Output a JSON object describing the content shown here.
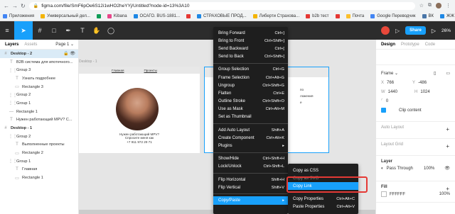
{
  "browser": {
    "url": "figma.com/file/SmF6pOe6S12i1wHO2heYYj/Untitled?node-id=13%3A10"
  },
  "bookmarks": [
    {
      "label": "Приложения",
      "color": "#4285f4"
    },
    {
      "label": "Универсальный дел...",
      "color": "#f4b400"
    },
    {
      "label": "",
      "color": "#0f9d58"
    },
    {
      "label": "Kibana",
      "color": "#e8478b"
    },
    {
      "label": "ОСАГО. BUS-1881...",
      "color": "#1e88e5"
    },
    {
      "label": "",
      "color": "#e53935"
    },
    {
      "label": "СТРАХОВЫЕ ПРОД...",
      "color": "#1e88e5"
    },
    {
      "label": "Либерти Страхова...",
      "color": "#f4b400"
    },
    {
      "label": "b2b тест",
      "color": "#e53935"
    },
    {
      "label": "",
      "color": "#e53935"
    },
    {
      "label": "Почта",
      "color": "#fbc02d"
    },
    {
      "label": "Google Переводчик",
      "color": "#4285f4"
    },
    {
      "label": "ВК",
      "color": "#4a76a8"
    },
    {
      "label": "ЖЖ",
      "color": "#1e88e5"
    }
  ],
  "toolbar": {
    "share_label": "Share",
    "zoom": "26%"
  },
  "left_panel": {
    "tabs": [
      "Layers",
      "Assets"
    ],
    "page_label": "Page 1 ⌄",
    "layers": [
      {
        "name": "Desktop - 2",
        "icon": "#",
        "indent": 0,
        "selected": true,
        "bold": true
      },
      {
        "name": "B2B система для ипотечного...",
        "icon": "T",
        "indent": 1
      },
      {
        "name": "Group 3",
        "icon": "⋮⋮",
        "indent": 1
      },
      {
        "name": "Узнать подробнее",
        "icon": "T",
        "indent": 2
      },
      {
        "name": "Rectangle 3",
        "icon": "▭",
        "indent": 2
      },
      {
        "name": "Group 2",
        "icon": "⋮⋮",
        "indent": 1
      },
      {
        "name": "Group 1",
        "icon": "⋮⋮",
        "indent": 1
      },
      {
        "name": "Rectangle 1",
        "icon": "—",
        "indent": 1
      },
      {
        "name": "Нужен работающий MPV? C...",
        "icon": "T",
        "indent": 1
      },
      {
        "name": "Desktop - 1",
        "icon": "#",
        "indent": 0,
        "bold": true
      },
      {
        "name": "Group 2",
        "icon": "⋮⋮",
        "indent": 1
      },
      {
        "name": "Выполненные проекты",
        "icon": "T",
        "indent": 2
      },
      {
        "name": "Rectangle 2",
        "icon": "▭",
        "indent": 2
      },
      {
        "name": "Group 1",
        "icon": "⋮⋮",
        "indent": 1
      },
      {
        "name": "Главная",
        "icon": "T",
        "indent": 2
      },
      {
        "name": "Rectangle 1",
        "icon": "▭",
        "indent": 2
      }
    ]
  },
  "canvas": {
    "frame_label": "Desktop - 1",
    "nav": [
      "Главная",
      "Проекты"
    ],
    "caption_lines": [
      "Нужен работающий MPV?",
      "Спросите меня как",
      "+7 911 972 29 71"
    ],
    "frame2_lines": [
      "по",
      "ложения",
      "е"
    ]
  },
  "context_menu": {
    "groups": [
      [
        {
          "label": "Bring Forward",
          "shortcut": "Ctrl+]"
        },
        {
          "label": "Bring to Front",
          "shortcut": "Ctrl+Shift+]"
        },
        {
          "label": "Send Backward",
          "shortcut": "Ctrl+["
        },
        {
          "label": "Send to Back",
          "shortcut": "Ctrl+Shift+["
        }
      ],
      [
        {
          "label": "Group Selection",
          "shortcut": "Ctrl+G"
        },
        {
          "label": "Frame Selection",
          "shortcut": "Ctrl+Alt+G"
        },
        {
          "label": "Ungroup",
          "shortcut": "Ctrl+Shift+G"
        },
        {
          "label": "Flatten",
          "shortcut": "Ctrl+E"
        },
        {
          "label": "Outline Stroke",
          "shortcut": "Ctrl+Shift+O"
        },
        {
          "label": "Use as Mask",
          "shortcut": "Ctrl+Alt+M"
        },
        {
          "label": "Set as Thumbnail",
          "shortcut": ""
        }
      ],
      [
        {
          "label": "Add Auto Layout",
          "shortcut": "Shift+A"
        },
        {
          "label": "Create Component",
          "shortcut": "Ctrl+Alt+K"
        },
        {
          "label": "Plugins",
          "shortcut": "▸"
        }
      ],
      [
        {
          "label": "Show/Hide",
          "shortcut": "Ctrl+Shift+H"
        },
        {
          "label": "Lock/Unlock",
          "shortcut": "Ctrl+Shift+L"
        }
      ],
      [
        {
          "label": "Flip Horizontal",
          "shortcut": "Shift+H"
        },
        {
          "label": "Flip Vertical",
          "shortcut": "Shift+V"
        }
      ],
      [
        {
          "label": "Copy/Paste",
          "shortcut": "▸",
          "highlight": true
        }
      ]
    ]
  },
  "submenu": {
    "items": [
      {
        "label": "Copy as CSS",
        "shortcut": ""
      },
      {
        "label": "Copy as SVG",
        "shortcut": "",
        "dim": true
      },
      {
        "label": "Copy Link",
        "shortcut": "",
        "highlight": true
      },
      {
        "label": "Copy Properties",
        "shortcut": "Ctrl+Alt+C"
      },
      {
        "label": "Paste Properties",
        "shortcut": "Ctrl+Alt+V"
      }
    ]
  },
  "right_panel": {
    "tabs": [
      "Design",
      "Prototype",
      "Code"
    ],
    "frame_label": "Frame ⌄",
    "x": "766",
    "y": "-486",
    "w": "1440",
    "h": "1024",
    "r": "0",
    "clip_label": "Clip content",
    "auto_layout": "Auto Layout",
    "layout_grid": "Layout Grid",
    "layer_title": "Layer",
    "blend": "Pass Through",
    "opacity": "100%",
    "fill_title": "Fill",
    "fill_hex": "FFFFFF",
    "fill_opacity": "100%"
  }
}
